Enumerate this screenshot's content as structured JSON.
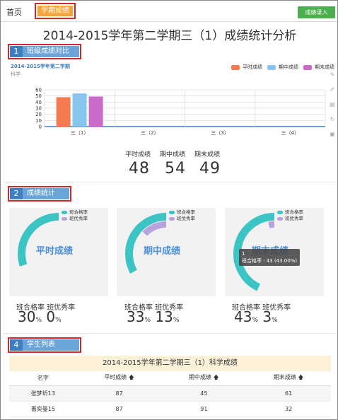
{
  "tabs": {
    "home": "首页",
    "active": "学期成绩"
  },
  "entry_button": "成绩录入",
  "page_title": "2014-2015学年第二学期三（1）成绩统计分析",
  "sections": [
    {
      "num": "1",
      "label": "班级成绩对比"
    },
    {
      "num": "2",
      "label": "成绩统计"
    },
    {
      "num": "4",
      "label": "学生列表"
    }
  ],
  "compare": {
    "subtitle": "2014-2015学年第二学期",
    "subject": "科学",
    "legend": [
      {
        "name": "平时成绩",
        "color": "#f47b4f"
      },
      {
        "name": "期中成绩",
        "color": "#87c5ef"
      },
      {
        "name": "期末成绩",
        "color": "#cc6acc"
      }
    ]
  },
  "chart_data": {
    "type": "bar",
    "categories": [
      "三（1）",
      "三（2）",
      "三（3）",
      "三（4）"
    ],
    "series": [
      {
        "name": "平时成绩",
        "values": [
          48,
          null,
          null,
          null
        ]
      },
      {
        "name": "期中成绩",
        "values": [
          54,
          null,
          null,
          null
        ]
      },
      {
        "name": "期末成绩",
        "values": [
          49,
          null,
          null,
          null
        ]
      }
    ],
    "yticks": [
      0,
      10,
      20,
      30,
      40,
      50,
      60
    ],
    "ylim": [
      0,
      60
    ],
    "grid": true,
    "legend_position": "top-right"
  },
  "stats": {
    "labels": [
      "平时成绩",
      "期中成绩",
      "期末成绩"
    ],
    "values": [
      "48",
      "54",
      "49"
    ]
  },
  "donuts": [
    {
      "center": "平时成绩",
      "pass_rate": 0.3,
      "excellent_rate": 0.0,
      "pass_text": "30",
      "exc_text": "0"
    },
    {
      "center": "期中成绩",
      "pass_rate": 0.33,
      "excellent_rate": 0.13,
      "pass_text": "33",
      "exc_text": "13"
    },
    {
      "center": "期末成绩",
      "pass_rate": 0.43,
      "excellent_rate": 0.03,
      "pass_text": "43",
      "exc_text": "3"
    }
  ],
  "donut_legend": {
    "pass": "班合格率",
    "excellent": "班优秀率"
  },
  "donut_colors": {
    "pass": "#3cc4c4",
    "excellent": "#b9a3dc",
    "bg": "#f2f2f2"
  },
  "rate_labels": {
    "pass": "班合格率",
    "excellent": "班优秀率",
    "unit": "%"
  },
  "tooltip": {
    "title": "1",
    "body": "班合格率 : 43 (43.00%)"
  },
  "table": {
    "title": "2014-2015学年第二学期三（1）科学成绩",
    "headers": [
      "名字",
      "平时成绩",
      "期中成绩",
      "期末成绩"
    ],
    "sort_icon": "arrow-up",
    "rows": [
      [
        "张梦圻13",
        "87",
        "45",
        "61"
      ],
      [
        "蓍奕曼15",
        "87",
        "91",
        "32"
      ]
    ]
  }
}
